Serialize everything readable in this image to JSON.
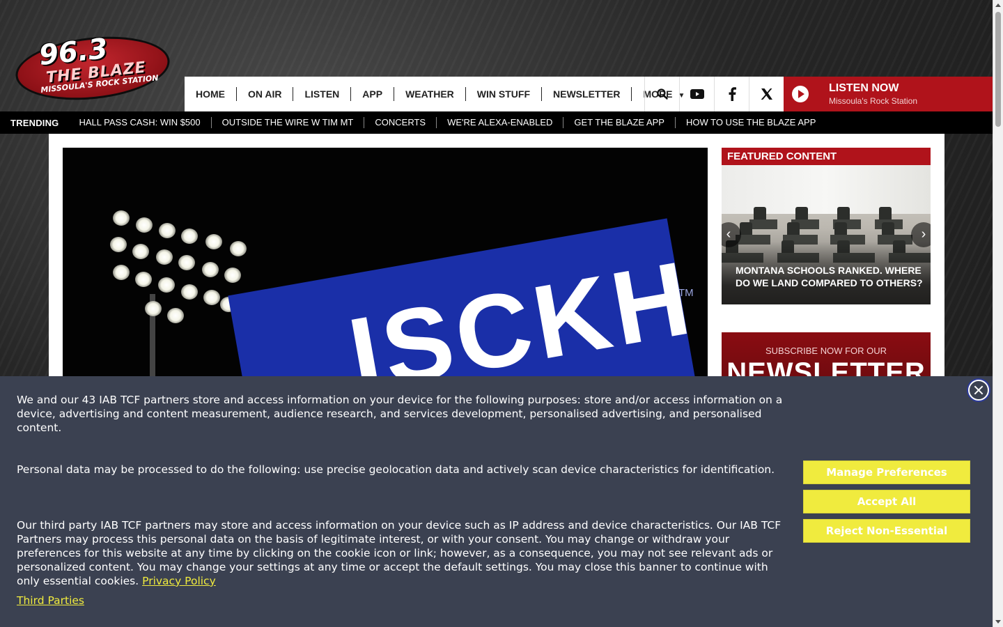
{
  "brand": {
    "frequency": "96.3",
    "name": "THE BLAZE",
    "tagline": "MISSOULA'S ROCK STATION",
    "accent": "#b0131b"
  },
  "nav": {
    "items": [
      {
        "label": "HOME"
      },
      {
        "label": "ON AIR"
      },
      {
        "label": "LISTEN"
      },
      {
        "label": "APP"
      },
      {
        "label": "WEATHER"
      },
      {
        "label": "WIN STUFF"
      },
      {
        "label": "NEWSLETTER"
      },
      {
        "label": "MORE"
      }
    ],
    "icons": [
      "search-icon",
      "youtube-icon",
      "facebook-icon",
      "x-twitter-icon"
    ],
    "listen_now": {
      "title": "LISTEN NOW",
      "subtitle": "Missoula's Rock Station"
    }
  },
  "trending": {
    "label": "TRENDING",
    "items": [
      "HALL PASS CASH: WIN $500",
      "OUTSIDE THE WIRE W TIM MT",
      "CONCERTS",
      "WE'RE ALEXA-ENABLED",
      "GET THE BLAZE APP",
      "HOW TO USE THE BLAZE APP"
    ]
  },
  "hero": {
    "sign_text": "ISCKH",
    "trademark": "TM"
  },
  "featured": {
    "header": "FEATURED CONTENT",
    "caption": "MONTANA SCHOOLS RANKED. WHERE DO WE LAND COMPARED TO OTHERS?"
  },
  "newsletter": {
    "small": "SUBSCRIBE NOW FOR OUR",
    "big": "NEWSLETTER"
  },
  "cookie": {
    "p1": "We and our 43 IAB TCF partners store and access information on your device for the following purposes: store and/or access information on a device, advertising and content measurement, audience research, and services development, personalised advertising, and personalised content.",
    "p2": "Personal data may be processed to do the following: use precise geolocation data and actively scan device characteristics for identification.",
    "p3": "Our third party IAB TCF partners may store and access information on your device such as IP address and device characteristics. Our IAB TCF Partners may process this personal data on the basis of legitimate interest, or with your consent. You may change or withdraw your preferences for this website at any time by clicking on the cookie icon or link; however, as a consequence, you may not see relevant ads or personalized content. You may change your settings at any time or accept the default settings. You may close this banner to continue with only essential cookies.",
    "privacy_link": "Privacy Policy",
    "third_parties_link": "Third Parties",
    "buttons": {
      "manage": "Manage Preferences",
      "accept": "Accept All",
      "reject": "Reject Non-Essential"
    },
    "button_color": "#f0eb3e"
  }
}
